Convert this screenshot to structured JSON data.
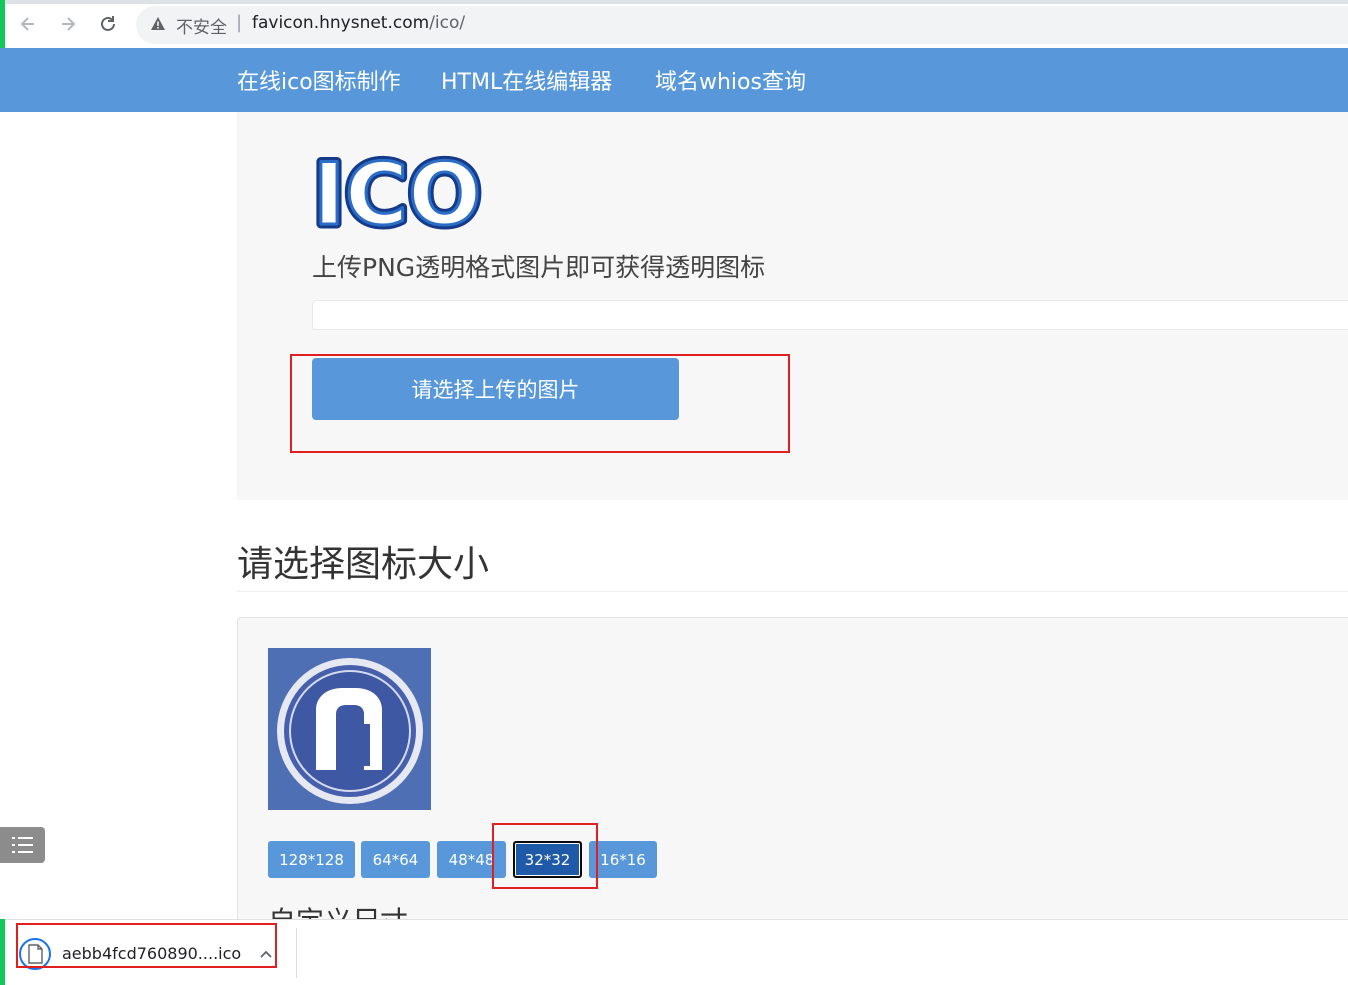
{
  "browser": {
    "insecure_label": "不安全",
    "separator": "|",
    "url_host": "favicon.hnysnet.com",
    "url_path": "/ico/",
    "icons": [
      "back-arrow-icon",
      "forward-arrow-icon",
      "reload-icon",
      "warning-triangle-icon"
    ]
  },
  "nav": {
    "items": [
      {
        "label": "在线ico图标制作"
      },
      {
        "label": "HTML在线编辑器"
      },
      {
        "label": "域名whios查询"
      }
    ],
    "background_color": "#5898da"
  },
  "upload": {
    "logo_text": "ICO",
    "hint": "上传PNG透明格式图片即可获得透明图标",
    "button_label": "请选择上传的图片"
  },
  "size_section": {
    "heading": "请选择图标大小",
    "preview_icon": "m4-logo-icon",
    "sizes": [
      {
        "label": "128*128",
        "selected": false
      },
      {
        "label": "64*64",
        "selected": false
      },
      {
        "label": "48*48",
        "selected": false
      },
      {
        "label": "32*32",
        "selected": true
      },
      {
        "label": "16*16",
        "selected": false
      }
    ],
    "custom_size_heading": "自定义尺寸"
  },
  "download_shelf": {
    "filename": "aebb4fcd760890....ico",
    "icons": [
      "file-icon",
      "chevron-up-icon"
    ]
  },
  "colors": {
    "accent": "#5898da",
    "selected_button": "#1f5aa8",
    "annotation_red": "#e02020",
    "green_edge": "#12c85b"
  }
}
